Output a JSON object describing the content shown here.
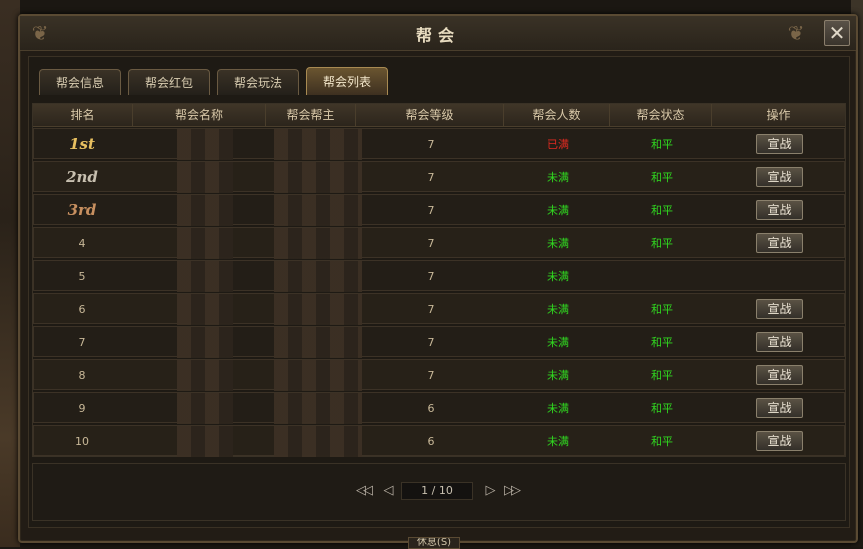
{
  "window": {
    "title": "帮会"
  },
  "tabs": [
    {
      "label": "帮会信息",
      "active": false
    },
    {
      "label": "帮会红包",
      "active": false
    },
    {
      "label": "帮会玩法",
      "active": false
    },
    {
      "label": "帮会列表",
      "active": true
    }
  ],
  "table": {
    "headers": [
      "排名",
      "帮会名称",
      "帮会帮主",
      "帮会等级",
      "帮会人数",
      "帮会状态",
      "操作"
    ],
    "rows": [
      {
        "rank": "1st",
        "level": "7",
        "members": "已满",
        "status": "和平",
        "action": "宣战"
      },
      {
        "rank": "2nd",
        "level": "7",
        "members": "未满",
        "status": "和平",
        "action": "宣战"
      },
      {
        "rank": "3rd",
        "level": "7",
        "members": "未满",
        "status": "和平",
        "action": "宣战"
      },
      {
        "rank": "4",
        "level": "7",
        "members": "未满",
        "status": "和平",
        "action": "宣战"
      },
      {
        "rank": "5",
        "level": "7",
        "members": "未满",
        "status": "",
        "action": ""
      },
      {
        "rank": "6",
        "level": "7",
        "members": "未满",
        "status": "和平",
        "action": "宣战"
      },
      {
        "rank": "7",
        "level": "7",
        "members": "未满",
        "status": "和平",
        "action": "宣战"
      },
      {
        "rank": "8",
        "level": "7",
        "members": "未满",
        "status": "和平",
        "action": "宣战"
      },
      {
        "rank": "9",
        "level": "6",
        "members": "未满",
        "status": "和平",
        "action": "宣战"
      },
      {
        "rank": "10",
        "level": "6",
        "members": "未满",
        "status": "和平",
        "action": "宣战"
      }
    ]
  },
  "pager": {
    "current": "1 / 10",
    "first_icon": "first-page-icon",
    "prev_icon": "prev-page-icon",
    "next_icon": "next-page-icon",
    "last_icon": "last-page-icon"
  },
  "colors": {
    "full": "#e02a20",
    "not_full": "#30d820",
    "peace": "#30d820"
  },
  "bottom": {
    "label": "休息(S)"
  }
}
